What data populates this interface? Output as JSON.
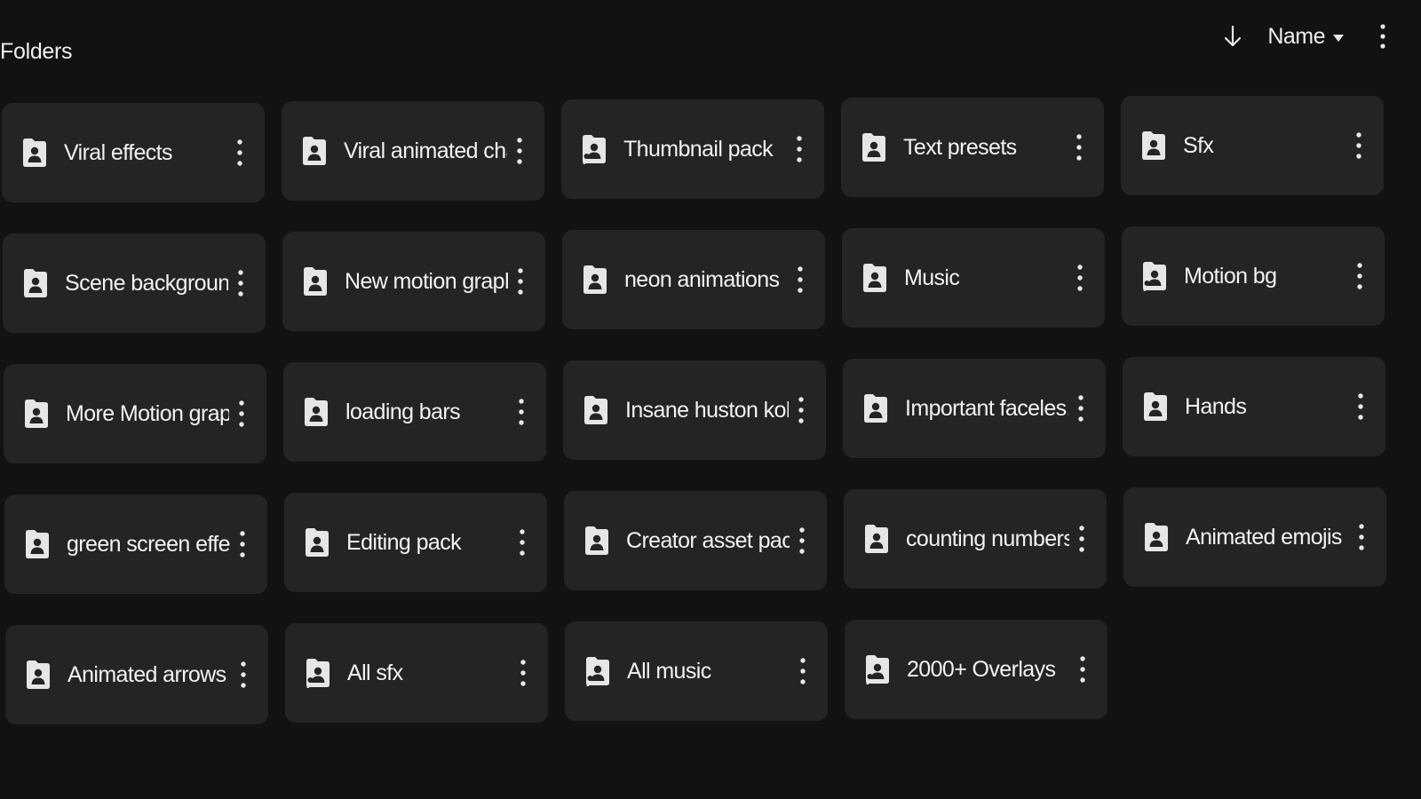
{
  "section": {
    "title": "Folders"
  },
  "toolbar": {
    "sort_direction_icon": "arrow-down-icon",
    "sort_label": "Name",
    "more_icon": "more-vert-icon"
  },
  "colors": {
    "background": "#121212",
    "card": "#242424",
    "text": "#f2f2f2",
    "icon": "#e6e6e6"
  },
  "folders": [
    {
      "label": "Viral effects",
      "icon": "shared-folder-icon"
    },
    {
      "label": "Viral animated cha...",
      "icon": "shared-folder-icon"
    },
    {
      "label": "Thumbnail pack",
      "icon": "shortcut-shared-folder-icon"
    },
    {
      "label": "Text presets",
      "icon": "shared-folder-icon"
    },
    {
      "label": "Sfx",
      "icon": "shared-folder-icon"
    },
    {
      "label": "Scene backgrounds",
      "icon": "shared-folder-icon"
    },
    {
      "label": "New motion graph...",
      "icon": "shared-folder-icon"
    },
    {
      "label": "neon animations",
      "icon": "shared-folder-icon"
    },
    {
      "label": "Music",
      "icon": "shared-folder-icon"
    },
    {
      "label": "Motion bg",
      "icon": "shortcut-shared-folder-icon"
    },
    {
      "label": "More Motion grap...",
      "icon": "shared-folder-icon"
    },
    {
      "label": "loading bars",
      "icon": "shared-folder-icon"
    },
    {
      "label": "Insane huston kol...",
      "icon": "shared-folder-icon"
    },
    {
      "label": "Important faceles...",
      "icon": "shared-folder-icon"
    },
    {
      "label": "Hands",
      "icon": "shared-folder-icon"
    },
    {
      "label": "green screen effe...",
      "icon": "shared-folder-icon"
    },
    {
      "label": "Editing pack",
      "icon": "shared-folder-icon"
    },
    {
      "label": "Creator asset packs",
      "icon": "shared-folder-icon"
    },
    {
      "label": "counting numbers",
      "icon": "shared-folder-icon"
    },
    {
      "label": "Animated emojis",
      "icon": "shared-folder-icon"
    },
    {
      "label": "Animated arrows",
      "icon": "shared-folder-icon"
    },
    {
      "label": "All sfx",
      "icon": "shortcut-shared-folder-icon"
    },
    {
      "label": "All music",
      "icon": "shortcut-shared-folder-icon"
    },
    {
      "label": "2000+ Overlays",
      "icon": "shortcut-shared-folder-icon"
    }
  ]
}
